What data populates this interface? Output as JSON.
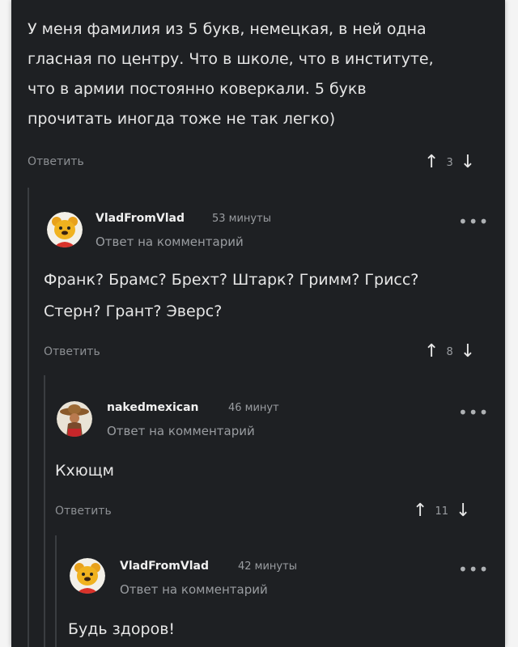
{
  "top_comment": {
    "lines": [
      "У меня фамилия из 5 букв, немецкая, в ней одна",
      "гласная по центру. Что в школе, что в институте,",
      "что в армии постоянно коверкали. 5 букв",
      "прочитать иногда тоже не так легко)"
    ],
    "reply_label": "Ответить",
    "votes": "3"
  },
  "replies": [
    {
      "author": "VladFromVlad",
      "time": "53 минуты",
      "reply_to": "Ответ на комментарий",
      "lines": [
        "Франк? Брамс? Брехт? Штарк? Гримм? Грисс?",
        "Стерн? Грант? Эверс?"
      ],
      "reply_label": "Ответить",
      "votes": "8",
      "avatar_icon": "yellow-bear-icon"
    },
    {
      "author": "nakedmexican",
      "time": "46 минут",
      "reply_to": "Ответ на комментарий",
      "lines": [
        "Кхющм"
      ],
      "reply_label": "Ответить",
      "votes": "11",
      "avatar_icon": "sombrero-man-icon"
    },
    {
      "author": "VladFromVlad",
      "time": "42 минуты",
      "reply_to": "Ответ на комментарий",
      "lines": [
        "Будь здоров!"
      ],
      "avatar_icon": "yellow-bear-icon"
    }
  ],
  "icons": {
    "up": "↑",
    "down": "↓",
    "more": "•••"
  },
  "colors": {
    "background": "#1e2023",
    "text": "#e6e6e6",
    "muted": "#8c8f93"
  }
}
